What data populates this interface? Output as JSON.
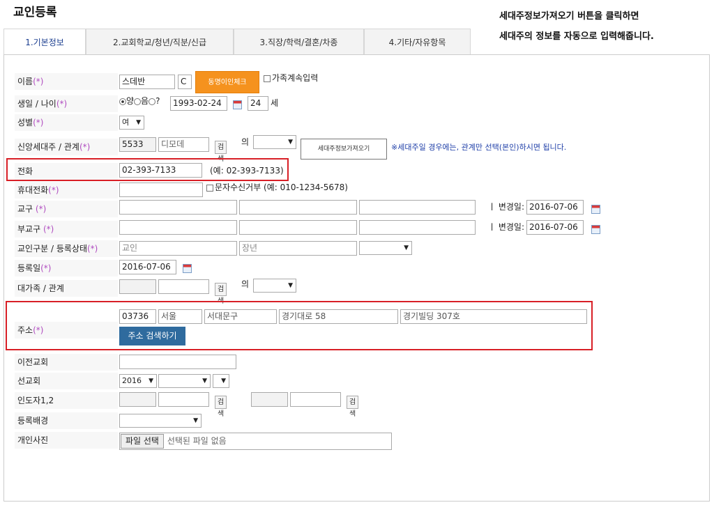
{
  "page_title": "교인등록",
  "help_text": [
    "세대주정보가져오기 버튼을 클릭하면",
    "세대주의 정보를 자동으로 입력해줍니다."
  ],
  "tabs": [
    "1.기본정보",
    "2.교회학교/청년/직분/신급",
    "3.직장/학력/결혼/차종",
    "4.기타/자유항목"
  ],
  "required_mark": "(*)",
  "name": {
    "label": "이름",
    "value": "스데반",
    "suffix": "C",
    "check_button": "동명이인체크",
    "family_checkbox": "가족계속입력"
  },
  "birth": {
    "label": "생일 / 나이",
    "lunar_options": [
      "양",
      "음",
      "?"
    ],
    "date": "1993-02-24",
    "age": "24",
    "age_unit": "세"
  },
  "gender": {
    "label": "성별",
    "value": "여"
  },
  "head": {
    "label": "신앙세대주 / 관계",
    "id": "5533",
    "name": "디모데",
    "search": "검색",
    "of": "의",
    "fetch_button": "세대주정보가져오기",
    "note": "※세대주일 경우에는, 관계만 선택(본인)하시면 됩니다."
  },
  "phone": {
    "label": "전화",
    "value": "02-393-7133",
    "example": "(예: 02-393-7133)"
  },
  "mobile": {
    "label": "휴대전화",
    "sms_refuse": "문자수신거부 (예: 010-1234-5678)"
  },
  "district": {
    "label": "교구",
    "change_label": "ㅣ 변경일:",
    "change_date": "2016-07-06"
  },
  "sub_district": {
    "label": "부교구",
    "change_label": "ㅣ 변경일:",
    "change_date": "2016-07-06"
  },
  "member_type": {
    "label": "교인구분 / 등록상태",
    "type": "교인",
    "status": "장년"
  },
  "reg_date": {
    "label": "등록일",
    "value": "2016-07-06"
  },
  "family_head": {
    "label": "대가족 / 관계",
    "search": "검색",
    "of": "의"
  },
  "address": {
    "label": "주소",
    "zip": "03736",
    "city": "서울",
    "district": "서대문구",
    "road": "경기대로 58",
    "detail": "경기빌딩 307호",
    "search_button": "주소 검색하기"
  },
  "prev_church": {
    "label": "이전교회"
  },
  "missionary": {
    "label": "선교회",
    "year": "2016"
  },
  "guide": {
    "label": "인도자1,2",
    "search": "검색"
  },
  "reg_background": {
    "label": "등록배경"
  },
  "photo": {
    "label": "개인사진",
    "file_button": "파일 선택",
    "file_status": "선택된 파일 없음"
  }
}
